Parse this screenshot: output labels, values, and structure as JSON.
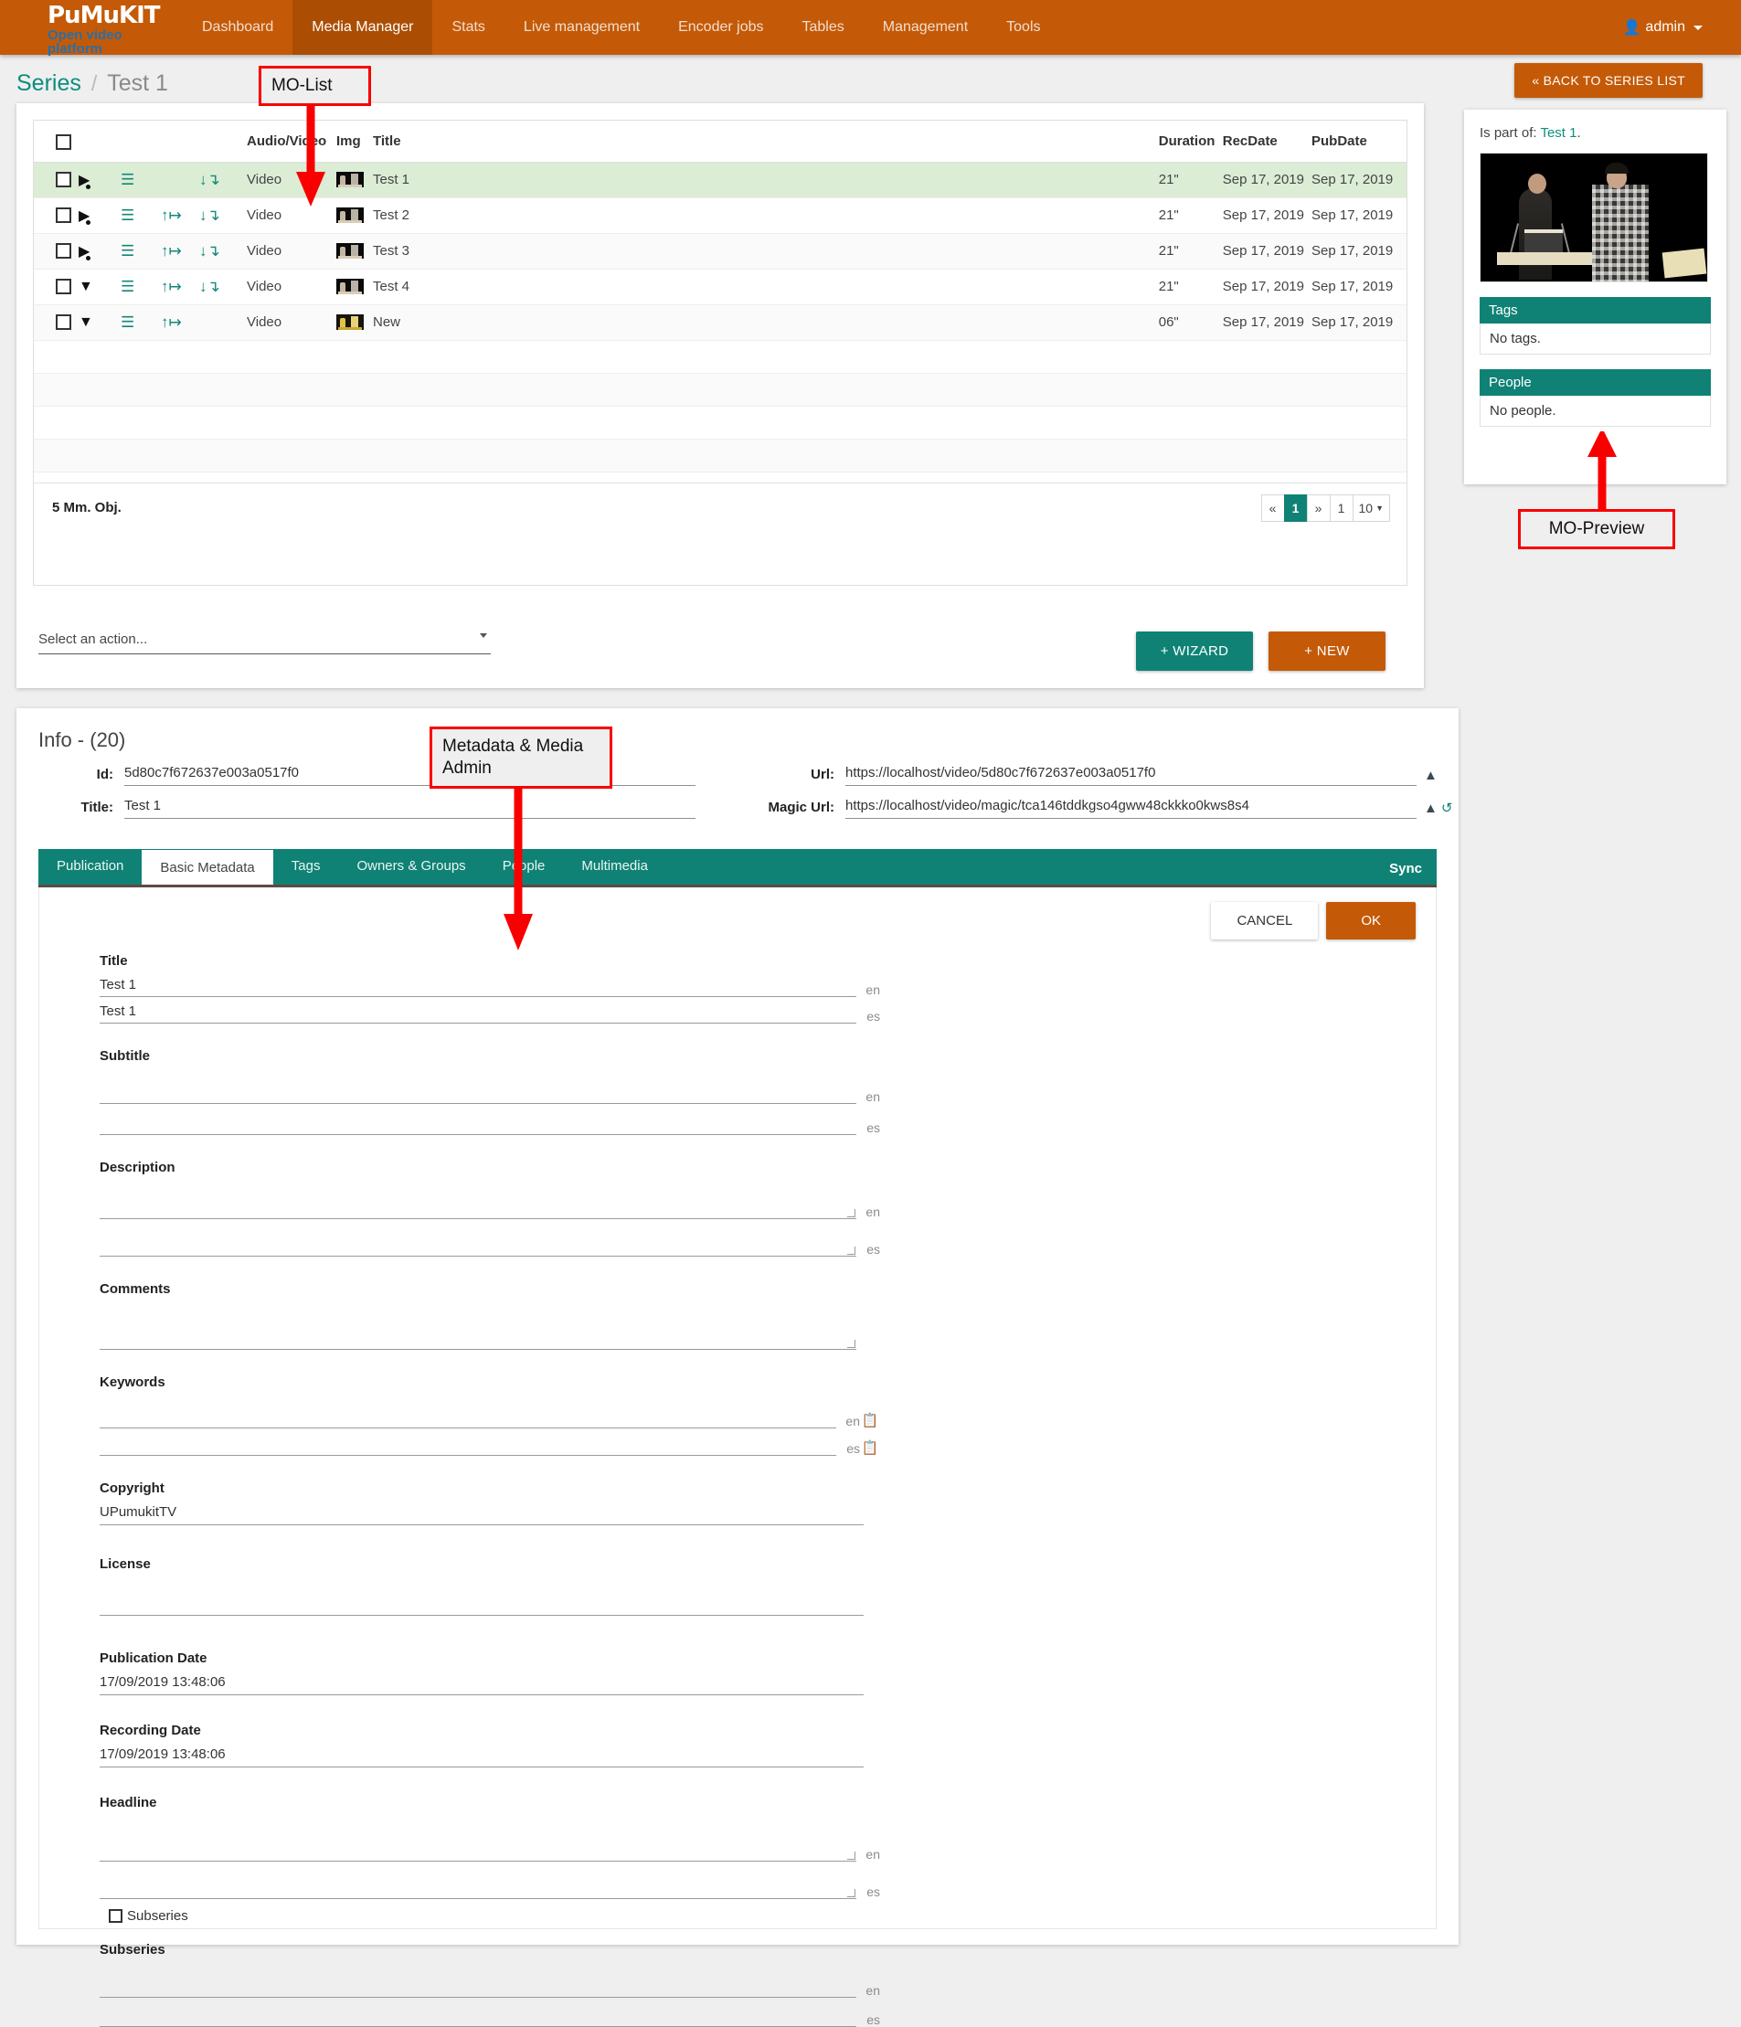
{
  "navbar": {
    "brand_top": "PuMuKIT",
    "brand_sub": "Open video platform",
    "items": [
      {
        "label": "Dashboard",
        "active": false
      },
      {
        "label": "Media Manager",
        "active": true
      },
      {
        "label": "Stats",
        "active": false
      },
      {
        "label": "Live management",
        "active": false
      },
      {
        "label": "Encoder jobs",
        "active": false
      },
      {
        "label": "Tables",
        "active": false
      },
      {
        "label": "Management",
        "active": false
      },
      {
        "label": "Tools",
        "active": false
      }
    ],
    "user": "admin",
    "user_icon": "user-icon"
  },
  "breadcrumb": {
    "root": "Series",
    "separator": "/",
    "current": "Test 1",
    "back_button": "« BACK TO SERIES LIST"
  },
  "callouts": {
    "mo_list": "MO-List",
    "mo_preview": "MO-Preview",
    "metadata_admin": "Metadata & Media Admin"
  },
  "mo_list": {
    "columns": [
      "",
      "",
      "",
      "",
      "",
      "Audio/Video",
      "Img",
      "Title",
      "Duration",
      "RecDate",
      "PubDate"
    ],
    "headers": {
      "audio_video": "Audio/Video",
      "img": "Img",
      "title": "Title",
      "duration": "Duration",
      "recdate": "RecDate",
      "pubdate": "PubDate"
    },
    "rows": [
      {
        "type": "Video",
        "title": "Test 1",
        "duration": "21\"",
        "recdate": "Sep 17, 2019",
        "pubdate": "Sep 17, 2019",
        "selected": true,
        "has_up": false,
        "has_down": true,
        "broadcast": "broadcast-private-icon",
        "thumb": "dark"
      },
      {
        "type": "Video",
        "title": "Test 2",
        "duration": "21\"",
        "recdate": "Sep 17, 2019",
        "pubdate": "Sep 17, 2019",
        "selected": false,
        "has_up": true,
        "has_down": true,
        "broadcast": "broadcast-private-icon",
        "thumb": "dark"
      },
      {
        "type": "Video",
        "title": "Test 3",
        "duration": "21\"",
        "recdate": "Sep 17, 2019",
        "pubdate": "Sep 17, 2019",
        "selected": false,
        "has_up": true,
        "has_down": true,
        "broadcast": "broadcast-private-icon",
        "thumb": "dark"
      },
      {
        "type": "Video",
        "title": "Test 4",
        "duration": "21\"",
        "recdate": "Sep 17, 2019",
        "pubdate": "Sep 17, 2019",
        "selected": false,
        "has_up": true,
        "has_down": true,
        "broadcast": "broadcast-public-icon",
        "thumb": "dark"
      },
      {
        "type": "Video",
        "title": "New",
        "duration": "06\"",
        "recdate": "Sep 17, 2019",
        "pubdate": "Sep 17, 2019",
        "selected": false,
        "has_up": true,
        "has_down": false,
        "broadcast": "broadcast-public-icon",
        "thumb": "yellow"
      }
    ],
    "count_label": "5 Mm. Obj.",
    "pager": {
      "prev": "«",
      "current": "1",
      "next": "»",
      "page_input": "1",
      "per_page": "10"
    },
    "action_select": "Select an action...",
    "wizard_button": "+ WIZARD",
    "new_button": "+ NEW"
  },
  "preview": {
    "is_part_of_label": "Is part of:",
    "is_part_of_link": "Test 1",
    "is_part_of_suffix": ".",
    "tags_title": "Tags",
    "tags_body": "No tags.",
    "people_title": "People",
    "people_body": "No people."
  },
  "info": {
    "title": "Info - (20)",
    "id_label": "Id:",
    "id_value": "5d80c7f672637e003a0517f0",
    "title_label": "Title:",
    "title_value": "Test 1",
    "url_label": "Url:",
    "url_value": "https://localhost/video/5d80c7f672637e003a0517f0",
    "magic_url_label": "Magic Url:",
    "magic_url_value": "https://localhost/video/magic/tca146tddkgso4gww48ckkko0kws8s4"
  },
  "tabs": {
    "items": [
      {
        "label": "Publication",
        "active": false
      },
      {
        "label": "Basic Metadata",
        "active": true
      },
      {
        "label": "Tags",
        "active": false
      },
      {
        "label": "Owners & Groups",
        "active": false
      },
      {
        "label": "People",
        "active": false
      },
      {
        "label": "Multimedia",
        "active": false
      }
    ],
    "sync": "Sync"
  },
  "form": {
    "cancel_button": "CANCEL",
    "ok_button": "OK",
    "lang_en": "en",
    "lang_es": "es",
    "title_label": "Title",
    "title_en": "Test 1",
    "title_es": "Test 1",
    "subtitle_label": "Subtitle",
    "subtitle_en": "",
    "subtitle_es": "",
    "description_label": "Description",
    "description_en": "",
    "description_es": "",
    "comments_label": "Comments",
    "comments_value": "",
    "keywords_label": "Keywords",
    "keywords_en": "",
    "keywords_es": "",
    "copyright_label": "Copyright",
    "copyright_value": "UPumukitTV",
    "license_label": "License",
    "license_value": "",
    "publication_date_label": "Publication Date",
    "publication_date_value": "17/09/2019 13:48:06",
    "recording_date_label": "Recording Date",
    "recording_date_value": "17/09/2019 13:48:06",
    "headline_label": "Headline",
    "headline_en": "",
    "headline_es": "",
    "subseries_checkbox_label": "Subseries",
    "subseries_label": "Subseries",
    "subseries_en": "",
    "subseries_es": ""
  },
  "colors": {
    "brand_orange": "#c45a07",
    "teal": "#0f8275",
    "selected_row": "#dbedd5",
    "callout_red": "#f90000"
  }
}
